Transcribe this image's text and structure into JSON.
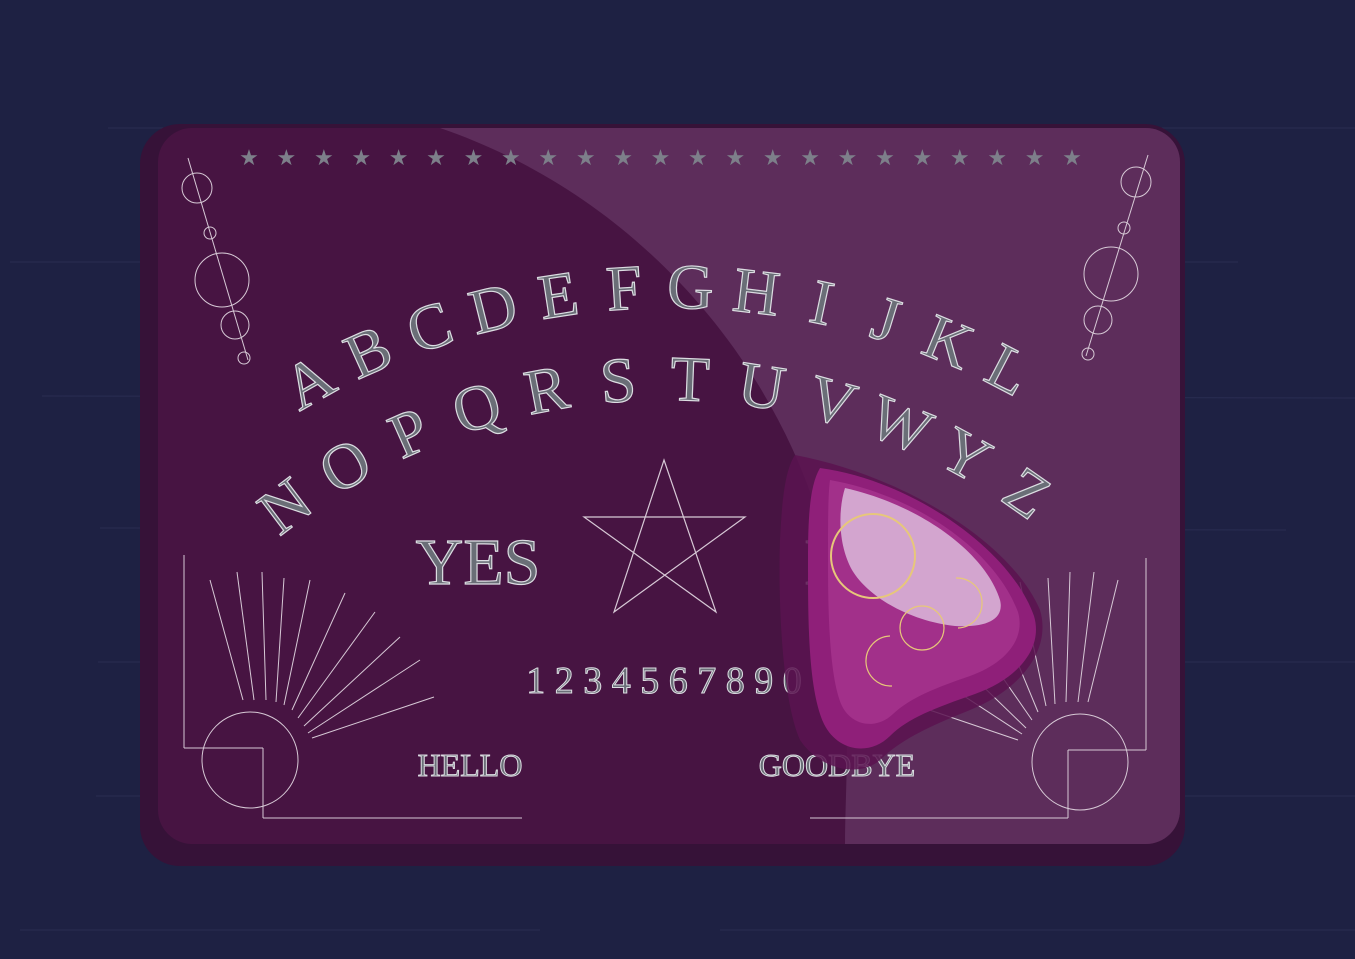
{
  "colors": {
    "background": "#1e2143",
    "board_shadow": "#361238",
    "board_face": "#471442",
    "board_gloss": "#5d2d5b",
    "letter_fill": "#6a6e77",
    "letter_stroke": "#dcdde2",
    "line": "#d7c9d6",
    "planchette": "#8f1f79",
    "planchette_dark": "#6a145a",
    "planchette_glass": "#d8b3d6",
    "planchette_gold": "#e7c77a"
  },
  "board": {
    "stars": [
      "★",
      "★",
      "★",
      "★",
      "★",
      "★",
      "★",
      "★",
      "★",
      "★",
      "★",
      "★",
      "★",
      "★",
      "★",
      "★",
      "★",
      "★",
      "★",
      "★",
      "★",
      "★",
      "★"
    ],
    "alphabet_row1": [
      "A",
      "B",
      "C",
      "D",
      "E",
      "F",
      "G",
      "H",
      "I",
      "J",
      "K",
      "L"
    ],
    "alphabet_row2": [
      "N",
      "O",
      "P",
      "Q",
      "R",
      "S",
      "T",
      "U",
      "V",
      "W",
      "Y",
      "Z"
    ],
    "yes": "YES",
    "no": "NO",
    "numbers": "1 2 3 4 5 6 7 8 9 0",
    "hello": "HELLO",
    "goodbye": "GOODBYE",
    "center_symbol": "pentagram-icon",
    "pointer": "planchette-icon"
  }
}
